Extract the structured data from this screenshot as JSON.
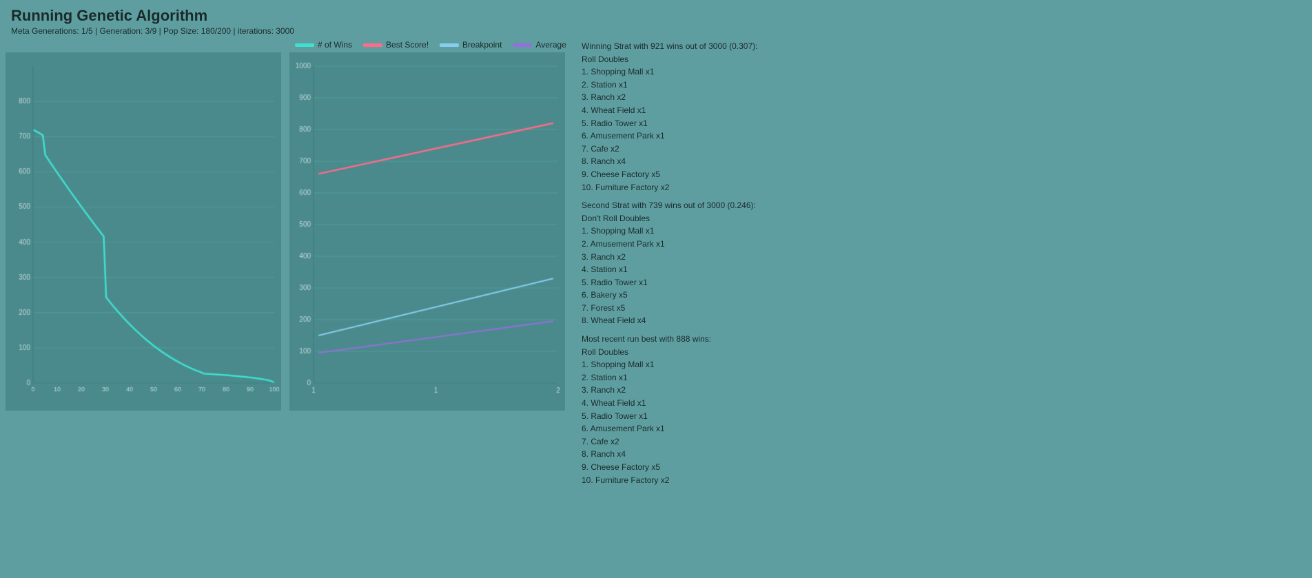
{
  "title": "Running Genetic Algorithm",
  "meta": "Meta Generations: 1/5 | Generation: 3/9 | Pop Size: 180/200 | iterations: 3000",
  "legend": {
    "wins_label": "# of Wins",
    "best_score_label": "Best Score!",
    "breakpoint_label": "Breakpoint",
    "average_label": "Average"
  },
  "winning_strat": {
    "header": "Winning Strat with 921 wins out of 3000 (0.307):",
    "roll": "Roll Doubles",
    "items": [
      "1. Shopping Mall x1",
      "2. Station x1",
      "3. Ranch x2",
      "4. Wheat Field x1",
      "5. Radio Tower x1",
      "6. Amusement Park x1",
      "7. Cafe x2",
      "8. Ranch x4",
      "9. Cheese Factory x5",
      "10. Furniture Factory x2"
    ]
  },
  "second_strat": {
    "header": "Second Strat with 739 wins out of 3000 (0.246):",
    "roll": "Don't Roll Doubles",
    "items": [
      "1. Shopping Mall x1",
      "2. Amusement Park x1",
      "3. Ranch x2",
      "4. Station x1",
      "5. Radio Tower x1",
      "6. Bakery x5",
      "7. Forest x5",
      "8. Wheat Field x4"
    ]
  },
  "recent_run": {
    "header": "Most recent run best with 888 wins:",
    "roll": "Roll Doubles",
    "items": [
      "1. Shopping Mall x1",
      "2. Station x1",
      "3. Ranch x2",
      "4. Wheat Field x1",
      "5. Radio Tower x1",
      "6. Amusement Park x1",
      "7. Cafe x2",
      "8. Ranch x4",
      "9. Cheese Factory x5",
      "10. Furniture Factory x2"
    ]
  },
  "colors": {
    "background": "#5f9ea0",
    "chart_bg": "#4a8a8c",
    "wins_line": "#40e0d0",
    "best_score_line": "#ff6b8a",
    "breakpoint_line": "#87ceeb",
    "average_line": "#9370db",
    "grid": "#5aacae"
  }
}
